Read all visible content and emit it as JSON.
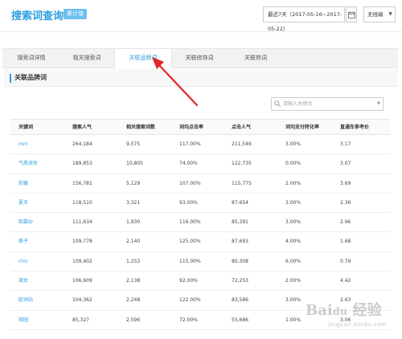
{
  "header": {
    "title": "搜索词查询",
    "badge": "累计值",
    "date_range": "最近7天（2017-05-16~2017-05-22）",
    "device_select": "无线端"
  },
  "tabs": [
    {
      "label": "搜索词详情"
    },
    {
      "label": "相关搜索词"
    },
    {
      "label": "关联品牌词"
    },
    {
      "label": "关联修饰词"
    },
    {
      "label": "关联热词"
    }
  ],
  "active_tab": "关联品牌词",
  "section": {
    "title": "关联品牌词"
  },
  "search": {
    "placeholder": "请输入关键词"
  },
  "table": {
    "headers": [
      "关键词",
      "搜索人气",
      "相关搜索词数",
      "词均点击率",
      "点击人气",
      "词均支付转化率",
      "直通车参考价"
    ],
    "rows": [
      [
        "mm",
        "264,184",
        "9,575",
        "117.00%",
        "211,546",
        "3.00%",
        "3.17"
      ],
      [
        "气质淑女",
        "189,853",
        "10,805",
        "74.00%",
        "122,735",
        "0.00%",
        "3.07"
      ],
      [
        "彩媛",
        "156,781",
        "5,129",
        "107.00%",
        "115,775",
        "2.00%",
        "3.69"
      ],
      [
        "夏天",
        "118,510",
        "3,321",
        "93.00%",
        "87,654",
        "3.00%",
        "2.36"
      ],
      [
        "韵慕纱",
        "111,634",
        "1,930",
        "116.00%",
        "85,391",
        "3.00%",
        "2.96"
      ],
      [
        "推子",
        "109,778",
        "2,140",
        "125.00%",
        "87,693",
        "4.00%",
        "1.68"
      ],
      [
        "chic",
        "109,402",
        "1,253",
        "115.00%",
        "80,308",
        "6.00%",
        "0.79"
      ],
      [
        "淑女",
        "106,609",
        "2,138",
        "92.00%",
        "72,253",
        "2.00%",
        "4.42"
      ],
      [
        "欧洲站",
        "104,362",
        "2,248",
        "122.00%",
        "83,586",
        "3.00%",
        "2.63"
      ],
      [
        "田园",
        "85,327",
        "2,596",
        "72.00%",
        "55,686",
        "1.00%",
        "3.06"
      ]
    ]
  },
  "watermark": {
    "text": "Baidu 经验",
    "sub": "jingyan.baidu.com"
  },
  "colors": {
    "accent": "#2e9ee0",
    "annotation_arrow": "#e0262a"
  },
  "icons": {
    "calendar": "calendar-icon",
    "search": "search-icon",
    "dropdown": "chevron-down-icon"
  }
}
